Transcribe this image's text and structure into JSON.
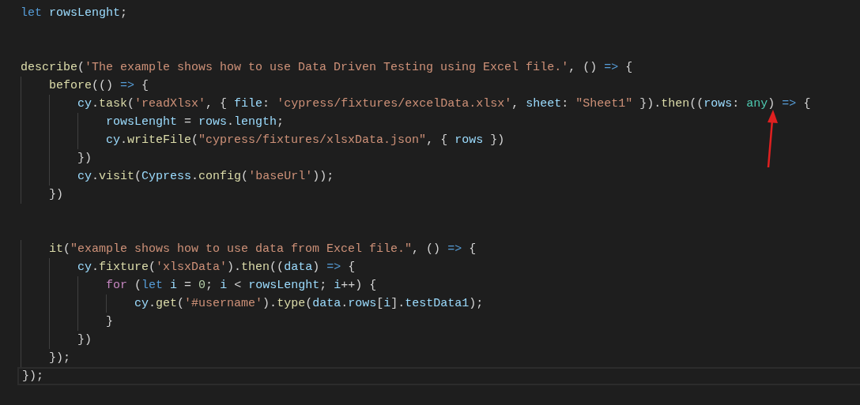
{
  "editor": {
    "lines": [
      {
        "current": false,
        "tokens": [
          {
            "text": "let",
            "kind": "keyword"
          },
          {
            "text": " rowsLenght",
            "kind": "variable"
          },
          {
            "text": ";",
            "kind": "plain"
          }
        ]
      },
      {
        "current": false
      },
      {
        "current": false
      },
      {
        "current": false,
        "tokens": [
          {
            "text": "describe",
            "kind": "function"
          },
          {
            "text": "(",
            "kind": "plain"
          },
          {
            "text": "'The example shows how to use Data Driven Testing using Excel file.'",
            "kind": "string"
          },
          {
            "text": ", () ",
            "kind": "plain"
          },
          {
            "text": "=>",
            "kind": "keyword"
          },
          {
            "text": " {",
            "kind": "plain"
          }
        ]
      },
      {
        "current": false,
        "tokens": [
          {
            "text": "    before",
            "kind": "function"
          },
          {
            "text": "(() ",
            "kind": "plain"
          },
          {
            "text": "=>",
            "kind": "keyword"
          },
          {
            "text": " {",
            "kind": "plain"
          }
        ]
      },
      {
        "current": false,
        "tokens": [
          {
            "text": "        cy",
            "kind": "variable"
          },
          {
            "text": ".",
            "kind": "plain"
          },
          {
            "text": "task",
            "kind": "function"
          },
          {
            "text": "(",
            "kind": "plain"
          },
          {
            "text": "'readXlsx'",
            "kind": "string"
          },
          {
            "text": ", { ",
            "kind": "plain"
          },
          {
            "text": "file",
            "kind": "variable"
          },
          {
            "text": ": ",
            "kind": "plain"
          },
          {
            "text": "'cypress/fixtures/excelData.xlsx'",
            "kind": "string"
          },
          {
            "text": ", ",
            "kind": "plain"
          },
          {
            "text": "sheet",
            "kind": "variable"
          },
          {
            "text": ": ",
            "kind": "plain"
          },
          {
            "text": "\"Sheet1\"",
            "kind": "string"
          },
          {
            "text": " }).",
            "kind": "plain"
          },
          {
            "text": "then",
            "kind": "function"
          },
          {
            "text": "((",
            "kind": "plain"
          },
          {
            "text": "rows",
            "kind": "variable"
          },
          {
            "text": ": ",
            "kind": "plain"
          },
          {
            "text": "any",
            "kind": "type"
          },
          {
            "text": ") ",
            "kind": "plain"
          },
          {
            "text": "=>",
            "kind": "keyword"
          },
          {
            "text": " {",
            "kind": "plain"
          }
        ]
      },
      {
        "current": false,
        "tokens": [
          {
            "text": "            rowsLenght",
            "kind": "variable"
          },
          {
            "text": " = ",
            "kind": "plain"
          },
          {
            "text": "rows",
            "kind": "variable"
          },
          {
            "text": ".",
            "kind": "plain"
          },
          {
            "text": "length",
            "kind": "variable"
          },
          {
            "text": ";",
            "kind": "plain"
          }
        ]
      },
      {
        "current": false,
        "tokens": [
          {
            "text": "            cy",
            "kind": "variable"
          },
          {
            "text": ".",
            "kind": "plain"
          },
          {
            "text": "writeFile",
            "kind": "function"
          },
          {
            "text": "(",
            "kind": "plain"
          },
          {
            "text": "\"cypress/fixtures/xlsxData.json\"",
            "kind": "string"
          },
          {
            "text": ", { ",
            "kind": "plain"
          },
          {
            "text": "rows",
            "kind": "variable"
          },
          {
            "text": " })",
            "kind": "plain"
          }
        ]
      },
      {
        "current": false,
        "tokens": [
          {
            "text": "        })",
            "kind": "plain"
          }
        ]
      },
      {
        "current": false,
        "tokens": [
          {
            "text": "        cy",
            "kind": "variable"
          },
          {
            "text": ".",
            "kind": "plain"
          },
          {
            "text": "visit",
            "kind": "function"
          },
          {
            "text": "(",
            "kind": "plain"
          },
          {
            "text": "Cypress",
            "kind": "variable"
          },
          {
            "text": ".",
            "kind": "plain"
          },
          {
            "text": "config",
            "kind": "function"
          },
          {
            "text": "(",
            "kind": "plain"
          },
          {
            "text": "'baseUrl'",
            "kind": "string"
          },
          {
            "text": "));",
            "kind": "plain"
          }
        ]
      },
      {
        "current": false,
        "tokens": [
          {
            "text": "    })",
            "kind": "plain"
          }
        ]
      },
      {
        "current": false
      },
      {
        "current": false
      },
      {
        "current": false,
        "tokens": [
          {
            "text": "    it",
            "kind": "function"
          },
          {
            "text": "(",
            "kind": "plain"
          },
          {
            "text": "\"example shows how to use data from Excel file.\"",
            "kind": "string"
          },
          {
            "text": ", () ",
            "kind": "plain"
          },
          {
            "text": "=>",
            "kind": "keyword"
          },
          {
            "text": " {",
            "kind": "plain"
          }
        ]
      },
      {
        "current": false,
        "tokens": [
          {
            "text": "        cy",
            "kind": "variable"
          },
          {
            "text": ".",
            "kind": "plain"
          },
          {
            "text": "fixture",
            "kind": "function"
          },
          {
            "text": "(",
            "kind": "plain"
          },
          {
            "text": "'xlsxData'",
            "kind": "string"
          },
          {
            "text": ").",
            "kind": "plain"
          },
          {
            "text": "then",
            "kind": "function"
          },
          {
            "text": "((",
            "kind": "plain"
          },
          {
            "text": "data",
            "kind": "variable"
          },
          {
            "text": ") ",
            "kind": "plain"
          },
          {
            "text": "=>",
            "kind": "keyword"
          },
          {
            "text": " {",
            "kind": "plain"
          }
        ]
      },
      {
        "current": false,
        "tokens": [
          {
            "text": "            for",
            "kind": "control"
          },
          {
            "text": " (",
            "kind": "plain"
          },
          {
            "text": "let",
            "kind": "keyword"
          },
          {
            "text": " i",
            "kind": "variable"
          },
          {
            "text": " = ",
            "kind": "plain"
          },
          {
            "text": "0",
            "kind": "number"
          },
          {
            "text": "; ",
            "kind": "plain"
          },
          {
            "text": "i",
            "kind": "variable"
          },
          {
            "text": " < ",
            "kind": "plain"
          },
          {
            "text": "rowsLenght",
            "kind": "variable"
          },
          {
            "text": "; ",
            "kind": "plain"
          },
          {
            "text": "i",
            "kind": "variable"
          },
          {
            "text": "++) {",
            "kind": "plain"
          }
        ]
      },
      {
        "current": false,
        "tokens": [
          {
            "text": "                cy",
            "kind": "variable"
          },
          {
            "text": ".",
            "kind": "plain"
          },
          {
            "text": "get",
            "kind": "function"
          },
          {
            "text": "(",
            "kind": "plain"
          },
          {
            "text": "'#username'",
            "kind": "string"
          },
          {
            "text": ").",
            "kind": "plain"
          },
          {
            "text": "type",
            "kind": "function"
          },
          {
            "text": "(",
            "kind": "plain"
          },
          {
            "text": "data",
            "kind": "variable"
          },
          {
            "text": ".",
            "kind": "plain"
          },
          {
            "text": "rows",
            "kind": "variable"
          },
          {
            "text": "[",
            "kind": "plain"
          },
          {
            "text": "i",
            "kind": "variable"
          },
          {
            "text": "].",
            "kind": "plain"
          },
          {
            "text": "testData1",
            "kind": "variable"
          },
          {
            "text": ");",
            "kind": "plain"
          }
        ]
      },
      {
        "current": false,
        "tokens": [
          {
            "text": "            }",
            "kind": "plain"
          }
        ]
      },
      {
        "current": false,
        "tokens": [
          {
            "text": "        })",
            "kind": "plain"
          }
        ]
      },
      {
        "current": false,
        "tokens": [
          {
            "text": "    });",
            "kind": "plain"
          }
        ]
      },
      {
        "current": true,
        "tokens": [
          {
            "text": "});",
            "kind": "plain"
          }
        ]
      }
    ]
  }
}
